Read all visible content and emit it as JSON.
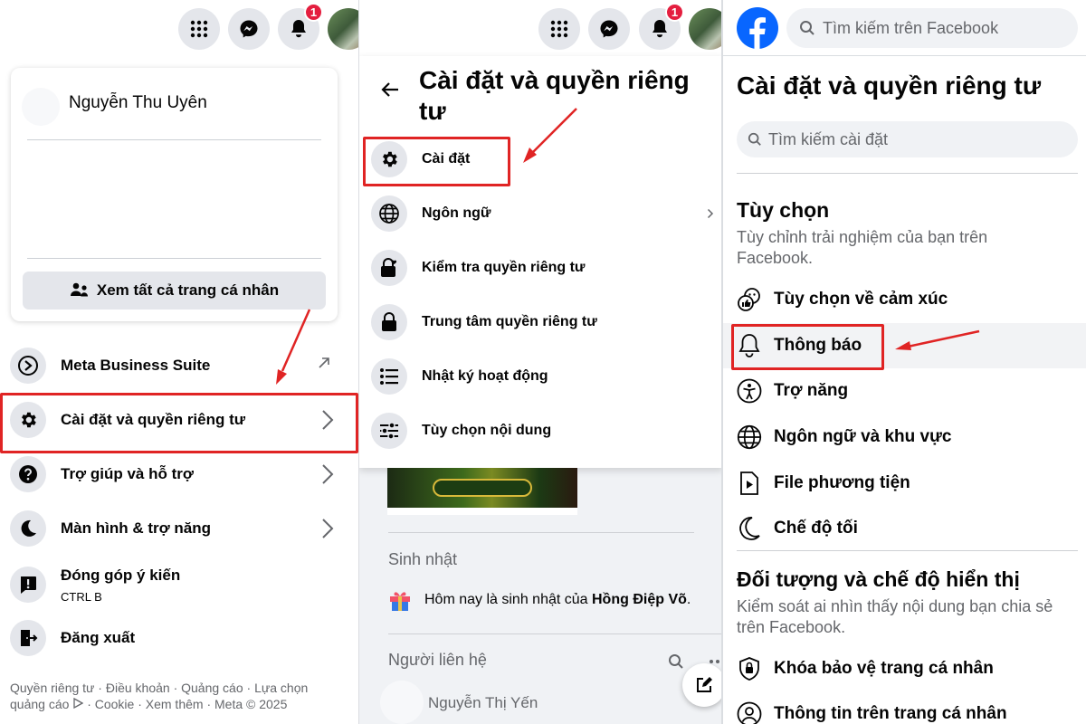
{
  "notifications": {
    "count": "1"
  },
  "panel1": {
    "profile_name": "Nguyễn Thu Uyên",
    "see_all_profiles": "Xem tất cả trang cá nhân",
    "menu": [
      {
        "label": "Meta Business Suite"
      },
      {
        "label": "Cài đặt và quyền riêng tư"
      },
      {
        "label": "Trợ giúp và hỗ trợ"
      },
      {
        "label": "Màn hình & trợ năng"
      },
      {
        "label": "Đóng góp ý kiến",
        "sub": "CTRL B"
      },
      {
        "label": "Đăng xuất"
      }
    ],
    "footer_line1": "Quyền riêng tư · Điều khoản · Quảng cáo · Lựa chọn",
    "footer_line2a": "quảng cáo",
    "footer_line2b": "· Cookie · Xem thêm · Meta © 2025"
  },
  "panel2": {
    "title_line1": "Cài đặt và quyền riêng",
    "title_line2": "tư",
    "menu": [
      {
        "label": "Cài đặt"
      },
      {
        "label": "Ngôn ngữ"
      },
      {
        "label": "Kiểm tra quyền riêng tư"
      },
      {
        "label": "Trung tâm quyền riêng tư"
      },
      {
        "label": "Nhật ký hoạt động"
      },
      {
        "label": "Tùy chọn nội dung"
      }
    ],
    "birthday_heading": "Sinh nhật",
    "birthday_text": "Hôm nay là sinh nhật của ",
    "birthday_name": "Hồng Điệp Võ",
    "birthday_end": ".",
    "contacts_heading": "Người liên hệ",
    "contact_name": "Nguyễn Thị Yến"
  },
  "panel3": {
    "search_placeholder": "Tìm kiếm trên Facebook",
    "title": "Cài đặt và quyền riêng tư",
    "settings_search_placeholder": "Tìm kiếm cài đặt",
    "section1_title": "Tùy chọn",
    "section1_desc_1": "Tùy chỉnh trải nghiệm của bạn trên",
    "section1_desc_2": "Facebook.",
    "section1_items": [
      {
        "label": "Tùy chọn về cảm xúc"
      },
      {
        "label": "Thông báo"
      },
      {
        "label": "Trợ năng"
      },
      {
        "label": "Ngôn ngữ và khu vực"
      },
      {
        "label": "File phương tiện"
      },
      {
        "label": "Chế độ tối"
      }
    ],
    "section2_title": "Đối tượng và chế độ hiển thị",
    "section2_desc_1": "Kiểm soát ai nhìn thấy nội dung bạn chia sẻ",
    "section2_desc_2": "trên Facebook.",
    "section2_items": [
      {
        "label": "Khóa bảo vệ trang cá nhân"
      },
      {
        "label": "Thông tin trên trang cá nhân"
      }
    ]
  },
  "colors": {
    "facebook_blue": "#0866ff",
    "highlight_red": "#e02424"
  }
}
